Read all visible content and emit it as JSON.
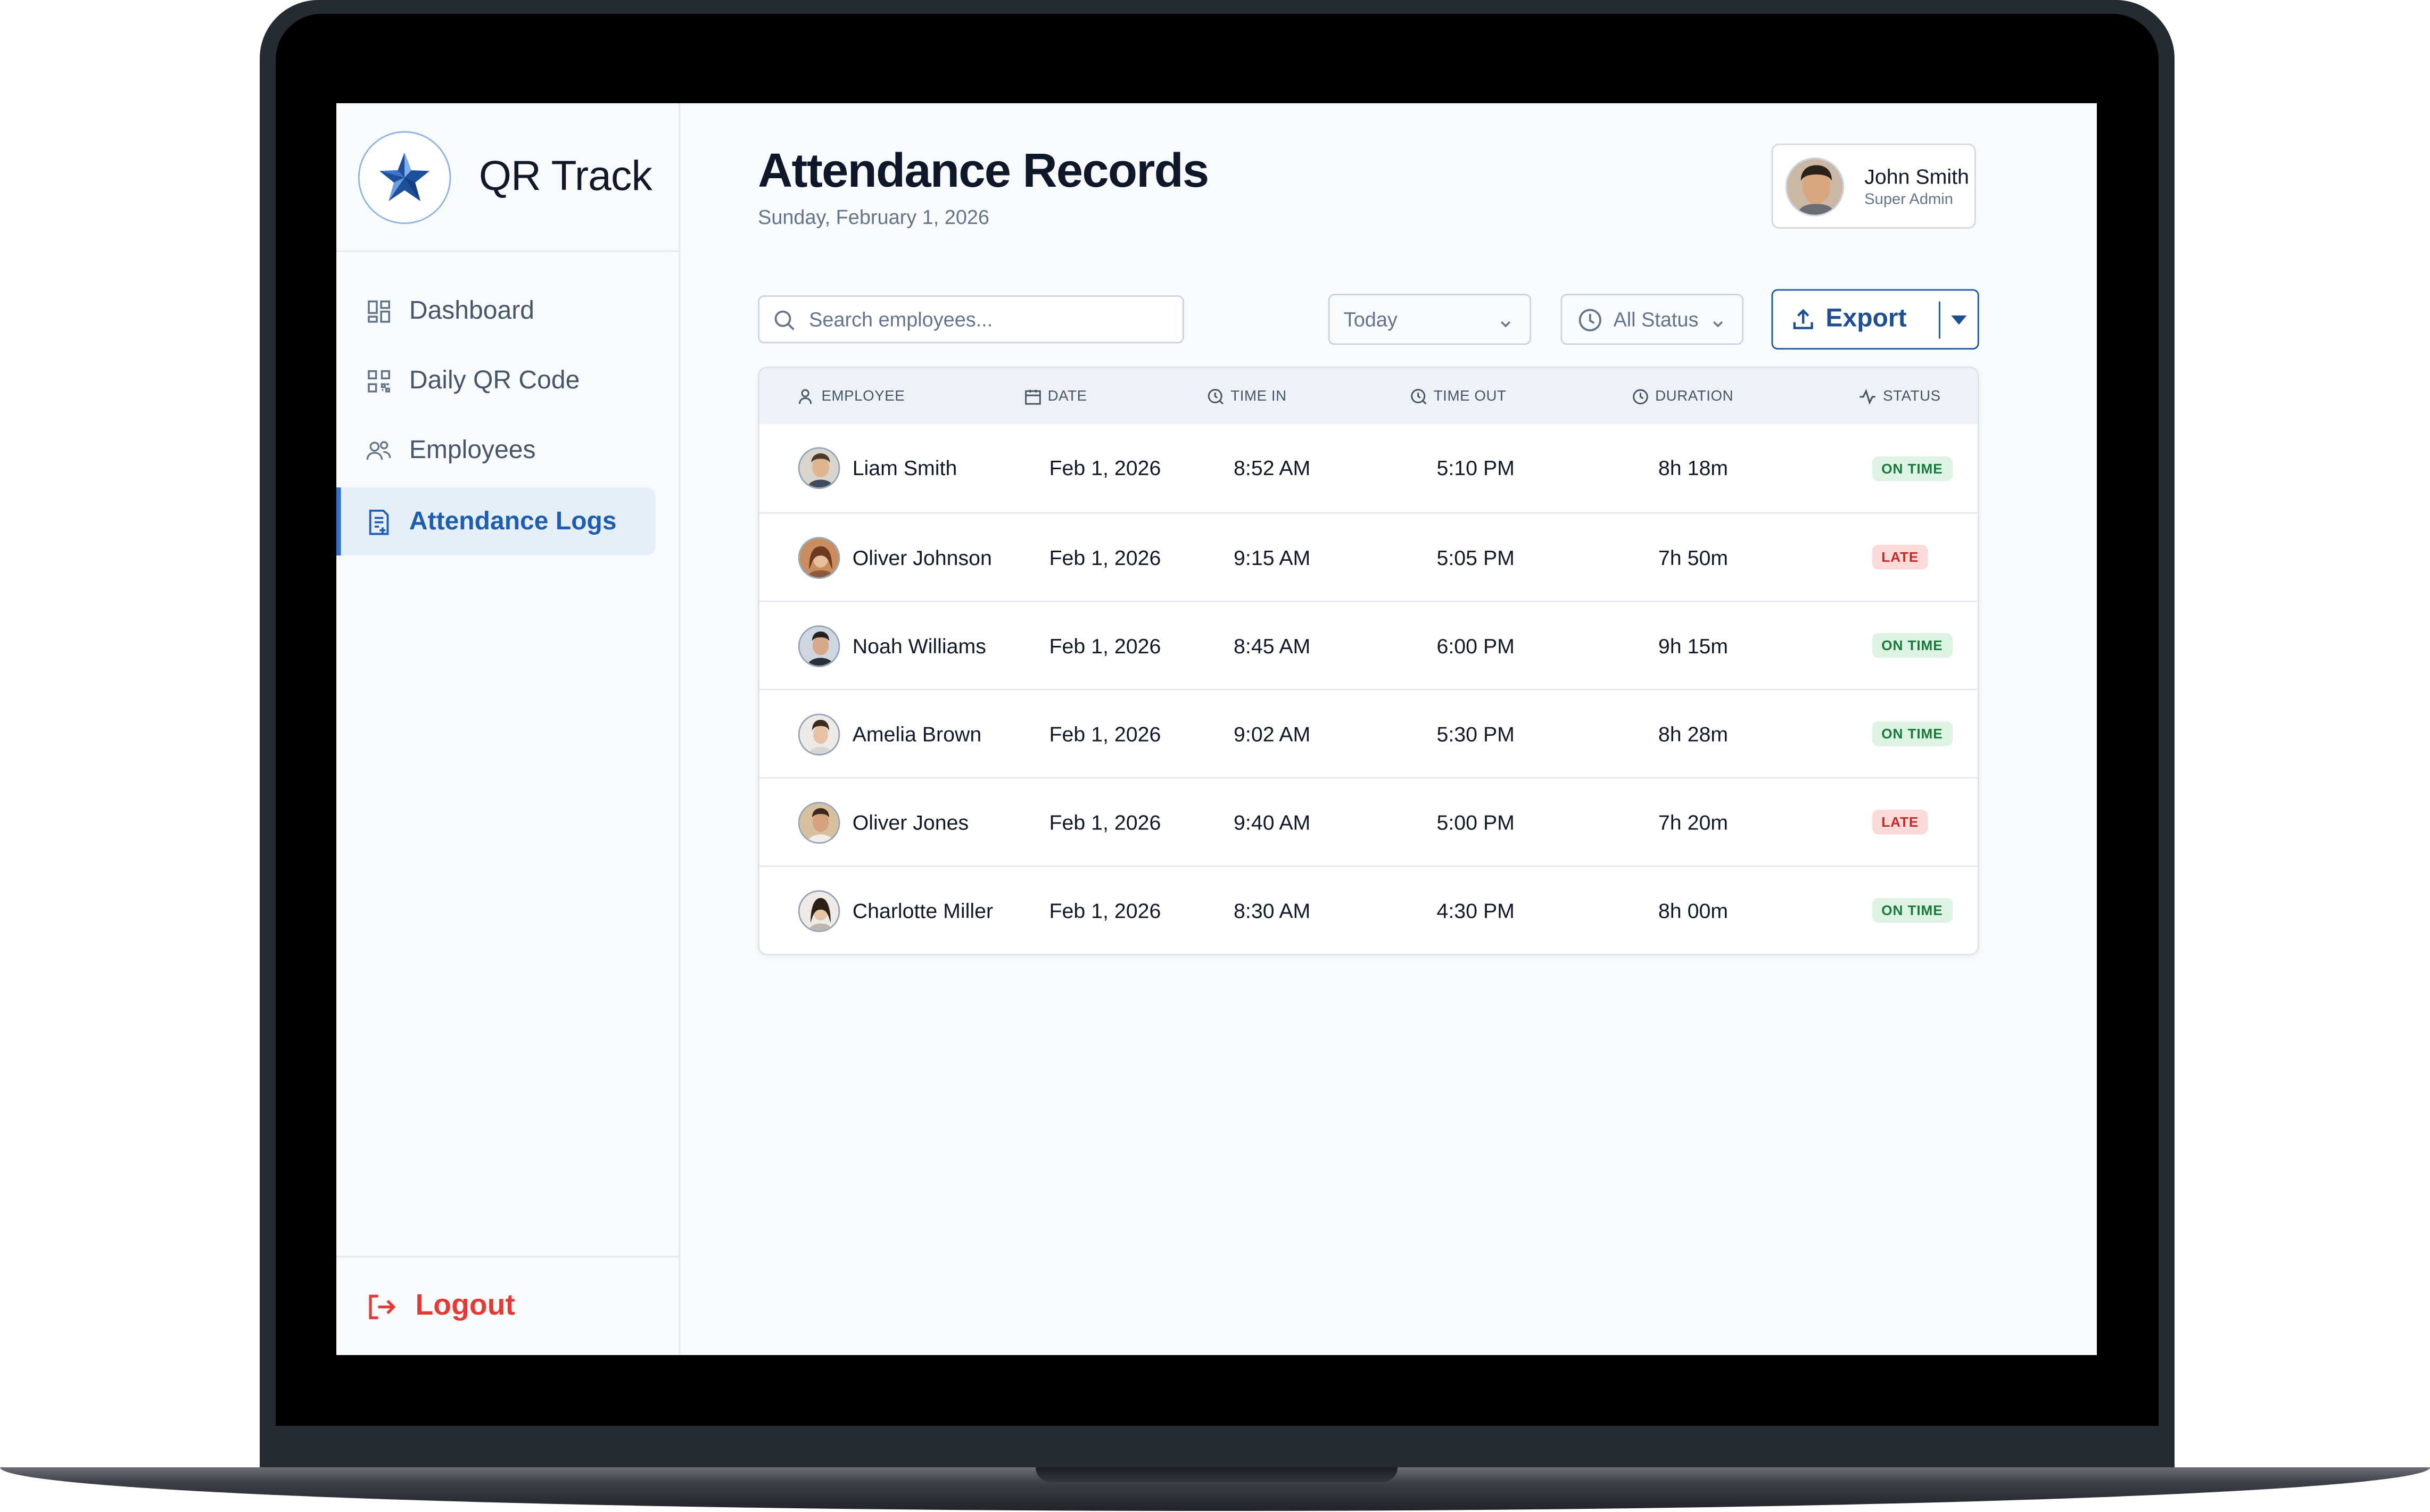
{
  "app": {
    "brand": "QR Track"
  },
  "sidebar": {
    "items": [
      {
        "label": "Dashboard"
      },
      {
        "label": "Daily QR Code"
      },
      {
        "label": "Employees"
      },
      {
        "label": "Attendance Logs"
      }
    ],
    "active_index": 3,
    "logout_label": "Logout"
  },
  "header": {
    "title": "Attendance Records",
    "date": "Sunday, February 1, 2026"
  },
  "user": {
    "name": "John Smith",
    "role": "Super Admin"
  },
  "toolbar": {
    "search_placeholder": "Search employees...",
    "date_filter": "Today",
    "status_filter": "All Status",
    "export_label": "Export"
  },
  "table": {
    "columns": [
      "EMPLOYEE",
      "DATE",
      "TIME IN",
      "TIME OUT",
      "DURATION",
      "STATUS"
    ],
    "rows": [
      {
        "name": "Liam Smith",
        "date": "Feb 1, 2026",
        "time_in": "8:52 AM",
        "time_out": "5:10 PM",
        "duration": "8h 18m",
        "status": "ON TIME"
      },
      {
        "name": "Oliver Johnson",
        "date": "Feb 1, 2026",
        "time_in": "9:15 AM",
        "time_out": "5:05 PM",
        "duration": "7h 50m",
        "status": "LATE"
      },
      {
        "name": "Noah Williams",
        "date": "Feb 1, 2026",
        "time_in": "8:45 AM",
        "time_out": "6:00 PM",
        "duration": "9h 15m",
        "status": "ON TIME"
      },
      {
        "name": "Amelia Brown",
        "date": "Feb 1, 2026",
        "time_in": "9:02 AM",
        "time_out": "5:30 PM",
        "duration": "8h 28m",
        "status": "ON TIME"
      },
      {
        "name": "Oliver Jones",
        "date": "Feb 1, 2026",
        "time_in": "9:40 AM",
        "time_out": "5:00 PM",
        "duration": "7h 20m",
        "status": "LATE"
      },
      {
        "name": "Charlotte Miller",
        "date": "Feb 1, 2026",
        "time_in": "8:30 AM",
        "time_out": "4:30 PM",
        "duration": "8h 00m",
        "status": "ON TIME"
      }
    ]
  },
  "colors": {
    "accent": "#1e5aa8",
    "sidebar_active_bg": "#e6eef8",
    "logout": "#e53935",
    "on_time_bg": "#dff3e4",
    "on_time_text": "#177a3a",
    "late_bg": "#fbdada",
    "late_text": "#c62828"
  },
  "icons": {
    "brand": "star-logo-icon",
    "nav": [
      "dashboard-icon",
      "qr-code-icon",
      "employees-icon",
      "attendance-log-icon"
    ],
    "logout": "logout-icon",
    "search": "search-icon",
    "status_filter": "clock-icon",
    "export": "upload-icon",
    "export_menu": "caret-down-icon"
  }
}
